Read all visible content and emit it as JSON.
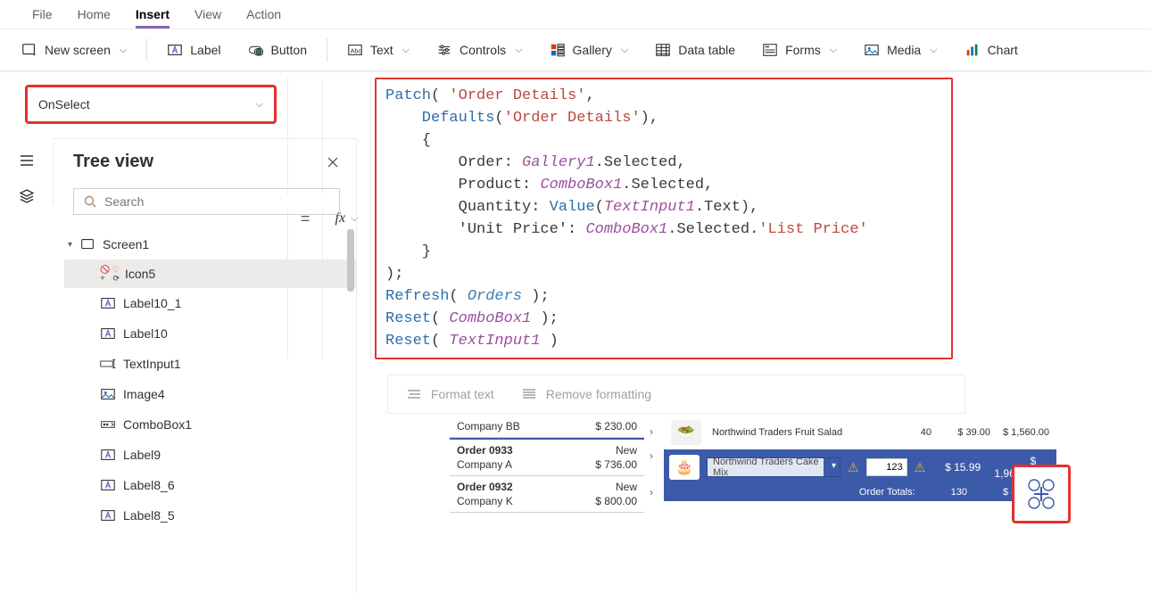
{
  "menu": {
    "file": "File",
    "home": "Home",
    "insert": "Insert",
    "view": "View",
    "action": "Action"
  },
  "ribbon": {
    "new_screen": "New screen",
    "label": "Label",
    "button": "Button",
    "text": "Text",
    "controls": "Controls",
    "gallery": "Gallery",
    "data_table": "Data table",
    "forms": "Forms",
    "media": "Media",
    "chart": "Chart"
  },
  "property": {
    "name": "OnSelect",
    "equals": "="
  },
  "fx_label": "fx",
  "formula": {
    "l1_a": "Patch",
    "l1_b": "(",
    "l1_c": " 'Order Details'",
    "l1_d": ",",
    "l2_a": "    Defaults",
    "l2_b": "(",
    "l2_c": "'Order Details'",
    "l2_d": "),",
    "l3": "    {",
    "l4_a": "        Order: ",
    "l4_b": "Gallery1",
    "l4_c": ".Selected,",
    "l5_a": "        Product: ",
    "l5_b": "ComboBox1",
    "l5_c": ".Selected,",
    "l6_a": "        Quantity: ",
    "l6_b": "Value",
    "l6_c": "(",
    "l6_d": "TextInput1",
    "l6_e": ".Text),",
    "l7_a": "        'Unit Price': ",
    "l7_b": "ComboBox1",
    "l7_c": ".Selected.",
    "l7_d": "'List Price'",
    "l8": "    }",
    "l9": ");",
    "l10_a": "Refresh",
    "l10_b": "( ",
    "l10_c": "Orders",
    "l10_d": " );",
    "l11_a": "Reset",
    "l11_b": "( ",
    "l11_c": "ComboBox1",
    "l11_d": " );",
    "l12_a": "Reset",
    "l12_b": "( ",
    "l12_c": "TextInput1",
    "l12_d": " )"
  },
  "format_bar": {
    "format": "Format text",
    "remove": "Remove formatting"
  },
  "tree": {
    "title": "Tree view",
    "search_placeholder": "Search",
    "items": [
      {
        "name": "Screen1",
        "type": "screen"
      },
      {
        "name": "Icon5",
        "type": "icon",
        "selected": true
      },
      {
        "name": "Label10_1",
        "type": "label"
      },
      {
        "name": "Label10",
        "type": "label"
      },
      {
        "name": "TextInput1",
        "type": "textinput"
      },
      {
        "name": "Image4",
        "type": "image"
      },
      {
        "name": "ComboBox1",
        "type": "combobox"
      },
      {
        "name": "Label9",
        "type": "label"
      },
      {
        "name": "Label8_6",
        "type": "label"
      },
      {
        "name": "Label8_5",
        "type": "label"
      }
    ]
  },
  "canvas": {
    "orders": [
      {
        "company": "Company BB",
        "amount": "$ 230.00"
      },
      {
        "caption": "Order 0933",
        "company": "Company A",
        "status": "New",
        "amount": "$ 736.00"
      },
      {
        "caption": "Order 0932",
        "company": "Company K",
        "status": "New",
        "amount": "$ 800.00"
      }
    ],
    "line": {
      "name": "Northwind Traders Fruit Salad",
      "qty": "40",
      "price": "$ 39.00",
      "total": "$ 1,560.00"
    },
    "selected": {
      "combo": "Northwind Traders Cake Mix",
      "qty": "123",
      "price": "$ 15.99",
      "total": "$ 1,966.77"
    },
    "totals": {
      "label": "Order Totals:",
      "qty": "130",
      "grand": "$ 3,810.00"
    }
  }
}
